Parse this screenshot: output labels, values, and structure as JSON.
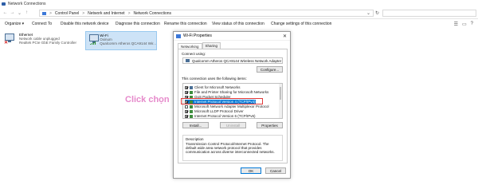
{
  "window": {
    "title": "Network Connections"
  },
  "address": {
    "crumbs": [
      "Control Panel",
      "Network and Internet",
      "Network Connections"
    ],
    "separator": ">"
  },
  "toolbar": {
    "organize": "Organize ▾",
    "connect_to": "Connect To",
    "disable": "Disable this network device",
    "diagnose": "Diagnose this connection",
    "rename": "Rename this connection",
    "view_status": "View status of this connection",
    "change_settings": "Change settings of this connection"
  },
  "adapters": [
    {
      "name": "Ethernet",
      "status": "Network cable unplugged",
      "device": "Realtek PCIe GbE Family Controller"
    },
    {
      "name": "Wi-Fi",
      "status": "Oxinum",
      "device": "Qualcomm Atheros QCA9144 Wir..."
    }
  ],
  "dialog": {
    "title": "Wi-Fi Properties",
    "close": "✕",
    "tabs": [
      "Networking",
      "Sharing"
    ],
    "connect_using_label": "Connect using:",
    "adapter_name": "Qualcomm Atheros QCA9144 Wireless Network Adapter",
    "configure": "Configure...",
    "items_label": "This connection uses the following items:",
    "items": [
      {
        "label": "Client for Microsoft Networks",
        "checked": true
      },
      {
        "label": "File and Printer Sharing for Microsoft Networks",
        "checked": true
      },
      {
        "label": "QoS Packet Scheduler",
        "checked": true
      },
      {
        "label": "Internet Protocol Version 4 (TCP/IPv4)",
        "checked": true,
        "selected": true
      },
      {
        "label": "Microsoft Network Adapter Multiplexor Protocol",
        "checked": false
      },
      {
        "label": "Microsoft LLDP Protocol Driver",
        "checked": true
      },
      {
        "label": "Internet Protocol Version 6 (TCP/IPv6)",
        "checked": true
      }
    ],
    "install": "Install...",
    "uninstall": "Uninstall",
    "properties": "Properties",
    "description_label": "Description",
    "description": "Transmission Control Protocol/Internet Protocol. The default wide area network protocol that provides communication across diverse interconnected networks.",
    "ok": "OK",
    "cancel": "Cancel"
  },
  "annotation": {
    "text": "Click chọn"
  },
  "colors": {
    "highlight": "#e03a3a",
    "annotation": "#e68acb",
    "selection": "#0078d7"
  }
}
